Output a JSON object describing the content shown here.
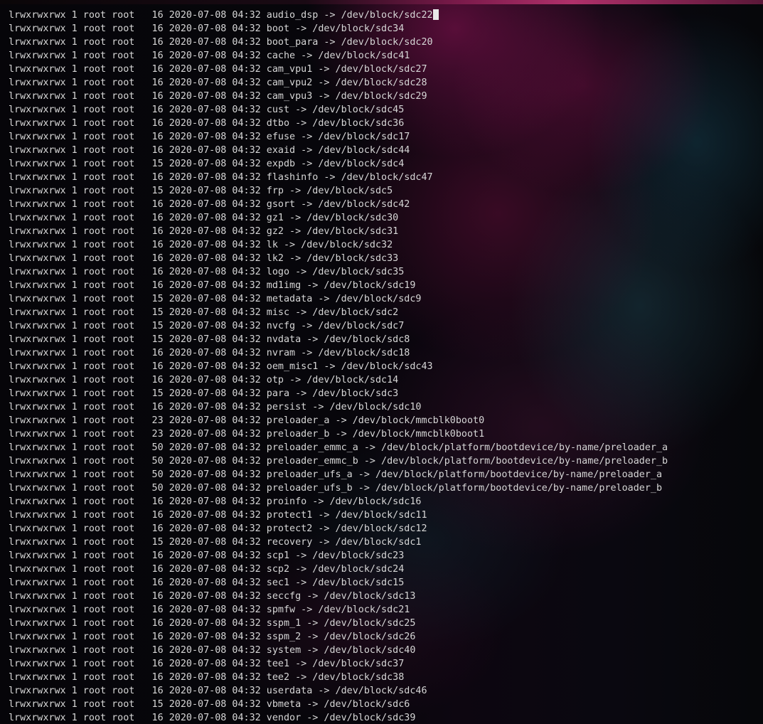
{
  "terminal": {
    "lines": [
      "lrwxrwxrwx 1 root root   16 2020-07-08 04:32 audio_dsp -> /dev/block/sdc22",
      "lrwxrwxrwx 1 root root   16 2020-07-08 04:32 boot -> /dev/block/sdc34",
      "lrwxrwxrwx 1 root root   16 2020-07-08 04:32 boot_para -> /dev/block/sdc20",
      "lrwxrwxrwx 1 root root   16 2020-07-08 04:32 cache -> /dev/block/sdc41",
      "lrwxrwxrwx 1 root root   16 2020-07-08 04:32 cam_vpu1 -> /dev/block/sdc27",
      "lrwxrwxrwx 1 root root   16 2020-07-08 04:32 cam_vpu2 -> /dev/block/sdc28",
      "lrwxrwxrwx 1 root root   16 2020-07-08 04:32 cam_vpu3 -> /dev/block/sdc29",
      "lrwxrwxrwx 1 root root   16 2020-07-08 04:32 cust -> /dev/block/sdc45",
      "lrwxrwxrwx 1 root root   16 2020-07-08 04:32 dtbo -> /dev/block/sdc36",
      "lrwxrwxrwx 1 root root   16 2020-07-08 04:32 efuse -> /dev/block/sdc17",
      "lrwxrwxrwx 1 root root   16 2020-07-08 04:32 exaid -> /dev/block/sdc44",
      "lrwxrwxrwx 1 root root   15 2020-07-08 04:32 expdb -> /dev/block/sdc4",
      "lrwxrwxrwx 1 root root   16 2020-07-08 04:32 flashinfo -> /dev/block/sdc47",
      "lrwxrwxrwx 1 root root   15 2020-07-08 04:32 frp -> /dev/block/sdc5",
      "lrwxrwxrwx 1 root root   16 2020-07-08 04:32 gsort -> /dev/block/sdc42",
      "lrwxrwxrwx 1 root root   16 2020-07-08 04:32 gz1 -> /dev/block/sdc30",
      "lrwxrwxrwx 1 root root   16 2020-07-08 04:32 gz2 -> /dev/block/sdc31",
      "lrwxrwxrwx 1 root root   16 2020-07-08 04:32 lk -> /dev/block/sdc32",
      "lrwxrwxrwx 1 root root   16 2020-07-08 04:32 lk2 -> /dev/block/sdc33",
      "lrwxrwxrwx 1 root root   16 2020-07-08 04:32 logo -> /dev/block/sdc35",
      "lrwxrwxrwx 1 root root   16 2020-07-08 04:32 md1img -> /dev/block/sdc19",
      "lrwxrwxrwx 1 root root   15 2020-07-08 04:32 metadata -> /dev/block/sdc9",
      "lrwxrwxrwx 1 root root   15 2020-07-08 04:32 misc -> /dev/block/sdc2",
      "lrwxrwxrwx 1 root root   15 2020-07-08 04:32 nvcfg -> /dev/block/sdc7",
      "lrwxrwxrwx 1 root root   15 2020-07-08 04:32 nvdata -> /dev/block/sdc8",
      "lrwxrwxrwx 1 root root   16 2020-07-08 04:32 nvram -> /dev/block/sdc18",
      "lrwxrwxrwx 1 root root   16 2020-07-08 04:32 oem_misc1 -> /dev/block/sdc43",
      "lrwxrwxrwx 1 root root   16 2020-07-08 04:32 otp -> /dev/block/sdc14",
      "lrwxrwxrwx 1 root root   15 2020-07-08 04:32 para -> /dev/block/sdc3",
      "lrwxrwxrwx 1 root root   16 2020-07-08 04:32 persist -> /dev/block/sdc10",
      "lrwxrwxrwx 1 root root   23 2020-07-08 04:32 preloader_a -> /dev/block/mmcblk0boot0",
      "lrwxrwxrwx 1 root root   23 2020-07-08 04:32 preloader_b -> /dev/block/mmcblk0boot1",
      "lrwxrwxrwx 1 root root   50 2020-07-08 04:32 preloader_emmc_a -> /dev/block/platform/bootdevice/by-name/preloader_a",
      "lrwxrwxrwx 1 root root   50 2020-07-08 04:32 preloader_emmc_b -> /dev/block/platform/bootdevice/by-name/preloader_b",
      "lrwxrwxrwx 1 root root   50 2020-07-08 04:32 preloader_ufs_a -> /dev/block/platform/bootdevice/by-name/preloader_a",
      "lrwxrwxrwx 1 root root   50 2020-07-08 04:32 preloader_ufs_b -> /dev/block/platform/bootdevice/by-name/preloader_b",
      "lrwxrwxrwx 1 root root   16 2020-07-08 04:32 proinfo -> /dev/block/sdc16",
      "lrwxrwxrwx 1 root root   16 2020-07-08 04:32 protect1 -> /dev/block/sdc11",
      "lrwxrwxrwx 1 root root   16 2020-07-08 04:32 protect2 -> /dev/block/sdc12",
      "lrwxrwxrwx 1 root root   15 2020-07-08 04:32 recovery -> /dev/block/sdc1",
      "lrwxrwxrwx 1 root root   16 2020-07-08 04:32 scp1 -> /dev/block/sdc23",
      "lrwxrwxrwx 1 root root   16 2020-07-08 04:32 scp2 -> /dev/block/sdc24",
      "lrwxrwxrwx 1 root root   16 2020-07-08 04:32 sec1 -> /dev/block/sdc15",
      "lrwxrwxrwx 1 root root   16 2020-07-08 04:32 seccfg -> /dev/block/sdc13",
      "lrwxrwxrwx 1 root root   16 2020-07-08 04:32 spmfw -> /dev/block/sdc21",
      "lrwxrwxrwx 1 root root   16 2020-07-08 04:32 sspm_1 -> /dev/block/sdc25",
      "lrwxrwxrwx 1 root root   16 2020-07-08 04:32 sspm_2 -> /dev/block/sdc26",
      "lrwxrwxrwx 1 root root   16 2020-07-08 04:32 system -> /dev/block/sdc40",
      "lrwxrwxrwx 1 root root   16 2020-07-08 04:32 tee1 -> /dev/block/sdc37",
      "lrwxrwxrwx 1 root root   16 2020-07-08 04:32 tee2 -> /dev/block/sdc38",
      "lrwxrwxrwx 1 root root   16 2020-07-08 04:32 userdata -> /dev/block/sdc46",
      "lrwxrwxrwx 1 root root   15 2020-07-08 04:32 vbmeta -> /dev/block/sdc6",
      "lrwxrwxrwx 1 root root   16 2020-07-08 04:32 vendor -> /dev/block/sdc39"
    ],
    "colors": {
      "text": "#d6d6d6",
      "cursor": "#e8e8e8",
      "background": "#050308",
      "accent": "#b0306a"
    }
  }
}
